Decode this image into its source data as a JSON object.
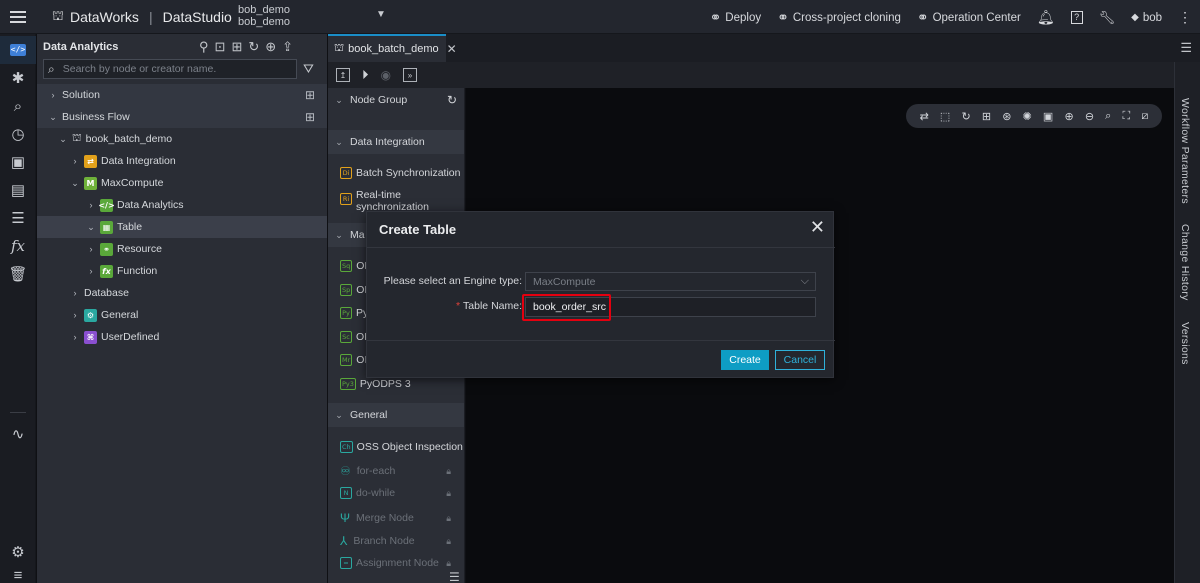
{
  "topbar": {
    "brand": "DataWorks",
    "product": "DataStudio",
    "workspace_line1": "bob_demo",
    "workspace_line2": "bob_demo",
    "links": [
      {
        "label": "Deploy"
      },
      {
        "label": "Cross-project cloning"
      },
      {
        "label": "Operation Center"
      }
    ],
    "user": "bob"
  },
  "explorer": {
    "title": "Data Analytics",
    "search_placeholder": "Search by node or creator name.",
    "tree": [
      {
        "label": "Solution"
      },
      {
        "label": "Business Flow"
      },
      {
        "label": "book_batch_demo"
      },
      {
        "label": "Data Integration"
      },
      {
        "label": "MaxCompute"
      },
      {
        "label": "Data Analytics"
      },
      {
        "label": "Table"
      },
      {
        "label": "Resource"
      },
      {
        "label": "Function"
      },
      {
        "label": "Database"
      },
      {
        "label": "General"
      },
      {
        "label": "UserDefined"
      }
    ]
  },
  "editor": {
    "tab_label": "book_batch_demo"
  },
  "components": {
    "node_group": "Node Group",
    "data_integration": "Data Integration",
    "batch_sync": "Batch Synchronization",
    "realtime_sync_1": "Real-time",
    "realtime_sync_2": "synchronization",
    "maxcompute_partial": "Ma",
    "odps_items": [
      {
        "tag": "Sq",
        "label": "OI"
      },
      {
        "tag": "Sp",
        "label": "OI"
      },
      {
        "tag": "Py",
        "label": "Py"
      },
      {
        "tag": "Sc",
        "label": "OI"
      },
      {
        "tag": "Mr",
        "label": "OI"
      },
      {
        "tag": "Py3",
        "label": "PyODPS 3"
      }
    ],
    "general": "General",
    "oss_inspection": "OSS Object Inspection",
    "for_each": "for-each",
    "do_while": "do-while",
    "merge_node": "Merge Node",
    "branch_node": "Branch Node",
    "assignment_node": "Assignment Node"
  },
  "rightbar": {
    "workflow_params": "Workflow Parameters",
    "change_history": "Change History",
    "versions": "Versions"
  },
  "modal": {
    "title": "Create Table",
    "engine_label": "Please select an Engine type:",
    "engine_value": "MaxCompute",
    "table_name_label": "Table Name:",
    "table_name_value": "book_order_src",
    "create_label": "Create",
    "cancel_label": "Cancel"
  },
  "colors": {
    "accent": "#0e9dc4",
    "highlight": "#e4000f",
    "required": "#e0423a"
  }
}
